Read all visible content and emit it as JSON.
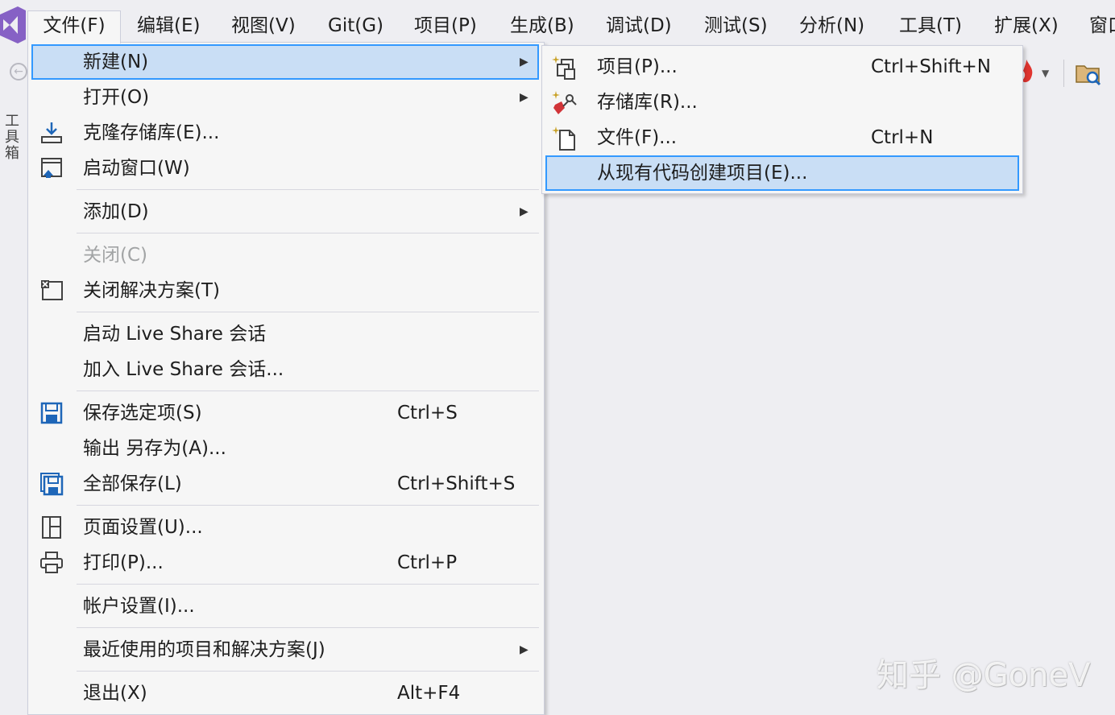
{
  "menubar": {
    "items": [
      {
        "label": "文件(F)"
      },
      {
        "label": "编辑(E)"
      },
      {
        "label": "视图(V)"
      },
      {
        "label": "Git(G)"
      },
      {
        "label": "项目(P)"
      },
      {
        "label": "生成(B)"
      },
      {
        "label": "调试(D)"
      },
      {
        "label": "测试(S)"
      },
      {
        "label": "分析(N)"
      },
      {
        "label": "工具(T)"
      },
      {
        "label": "扩展(X)"
      },
      {
        "label": "窗口"
      }
    ]
  },
  "side_strip": {
    "label": "工具箱"
  },
  "file_menu": {
    "items": [
      {
        "label": "新建(N)",
        "icon": "none",
        "submenu": true,
        "highlighted": true
      },
      {
        "label": "打开(O)",
        "icon": "none",
        "submenu": true
      },
      {
        "label": "克隆存储库(E)...",
        "icon": "clone-download-icon"
      },
      {
        "label": "启动窗口(W)",
        "icon": "start-window-icon"
      },
      {
        "label": "添加(D)",
        "icon": "none",
        "submenu": true
      },
      {
        "label": "关闭(C)",
        "icon": "none",
        "disabled": true
      },
      {
        "label": "关闭解决方案(T)",
        "icon": "close-solution-icon"
      },
      {
        "label": "启动 Live Share 会话",
        "icon": "none"
      },
      {
        "label": "加入 Live Share 会话...",
        "icon": "none"
      },
      {
        "label": "保存选定项(S)",
        "icon": "save-icon",
        "shortcut": "Ctrl+S"
      },
      {
        "label": "输出 另存为(A)...",
        "icon": "none"
      },
      {
        "label": "全部保存(L)",
        "icon": "save-all-icon",
        "shortcut": "Ctrl+Shift+S"
      },
      {
        "label": "页面设置(U)...",
        "icon": "page-setup-icon"
      },
      {
        "label": "打印(P)...",
        "icon": "printer-icon",
        "shortcut": "Ctrl+P"
      },
      {
        "label": "帐户设置(I)...",
        "icon": "none"
      },
      {
        "label": "最近使用的项目和解决方案(J)",
        "icon": "none",
        "submenu": true
      },
      {
        "label": "退出(X)",
        "icon": "none",
        "shortcut": "Alt+F4"
      }
    ]
  },
  "new_submenu": {
    "items": [
      {
        "label": "项目(P)...",
        "icon": "new-project-icon",
        "shortcut": "Ctrl+Shift+N"
      },
      {
        "label": "存储库(R)...",
        "icon": "new-repository-icon"
      },
      {
        "label": "文件(F)...",
        "icon": "new-file-icon",
        "shortcut": "Ctrl+N"
      },
      {
        "label": "从现有代码创建项目(E)...",
        "icon": "none",
        "highlighted": true
      }
    ]
  },
  "watermark": {
    "text": "知乎 @GoneV"
  },
  "colors": {
    "menu_bg": "#f6f6f6",
    "highlight_bg": "#c9def5",
    "highlight_border": "#3399ff",
    "disabled_text": "#a2a4a5",
    "vs_purple": "#68217a"
  }
}
